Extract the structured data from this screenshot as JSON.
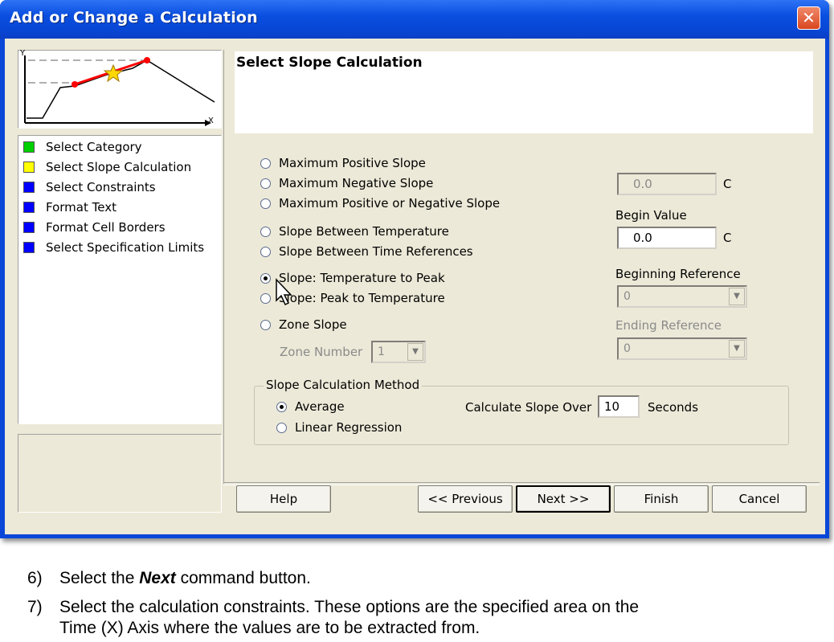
{
  "window": {
    "title": "Add or Change a Calculation",
    "close_glyph": "✕"
  },
  "thumbnail": {
    "y_axis": "Y",
    "x_axis": "X"
  },
  "steps": [
    {
      "label": "Select Category",
      "color": "#00d000"
    },
    {
      "label": "Select Slope Calculation",
      "color": "#ffff00"
    },
    {
      "label": "Select Constraints",
      "color": "#0000ff"
    },
    {
      "label": "Format Text",
      "color": "#0000ff"
    },
    {
      "label": "Format Cell Borders",
      "color": "#0000ff"
    },
    {
      "label": "Select Specification Limits",
      "color": "#0000ff"
    }
  ],
  "panel": {
    "title": "Select Slope Calculation",
    "options": [
      {
        "label": "Maximum Positive Slope",
        "selected": false
      },
      {
        "label": "Maximum Negative Slope",
        "selected": false
      },
      {
        "label": "Maximum Positive or Negative Slope",
        "selected": false
      },
      {
        "label": "Slope Between Temperature",
        "selected": false
      },
      {
        "label": "Slope Between Time References",
        "selected": false
      },
      {
        "label": "Slope: Temperature to Peak",
        "selected": true
      },
      {
        "label": "Slope: Peak to Temperature",
        "selected": false
      },
      {
        "label": "Zone Slope",
        "selected": false
      }
    ],
    "zone_number_label": "Zone Number",
    "zone_number_value": "1",
    "end_value": "0.0",
    "end_unit": "C",
    "begin_value_label": "Begin Value",
    "begin_value": "0.0",
    "begin_unit": "C",
    "beginning_reference_label": "Beginning Reference",
    "beginning_reference_value": "0",
    "ending_reference_label": "Ending Reference",
    "ending_reference_value": "0",
    "method": {
      "title": "Slope Calculation Method",
      "average_label": "Average",
      "average_selected": true,
      "linear_label": "Linear Regression",
      "linear_selected": false,
      "over_label": "Calculate Slope Over",
      "over_value": "10",
      "over_unit": "Seconds"
    }
  },
  "buttons": {
    "help": "Help",
    "previous": "<< Previous",
    "next": "Next >>",
    "finish": "Finish",
    "cancel": "Cancel"
  },
  "instructions": [
    {
      "num": "6)",
      "before": "Select the ",
      "bold": "Next",
      "after": " command button."
    },
    {
      "num": "7)",
      "line1": "Select the calculation constraints. These options are the specified area on the",
      "line2": "Time (X) Axis where the values are to be extracted from."
    }
  ]
}
